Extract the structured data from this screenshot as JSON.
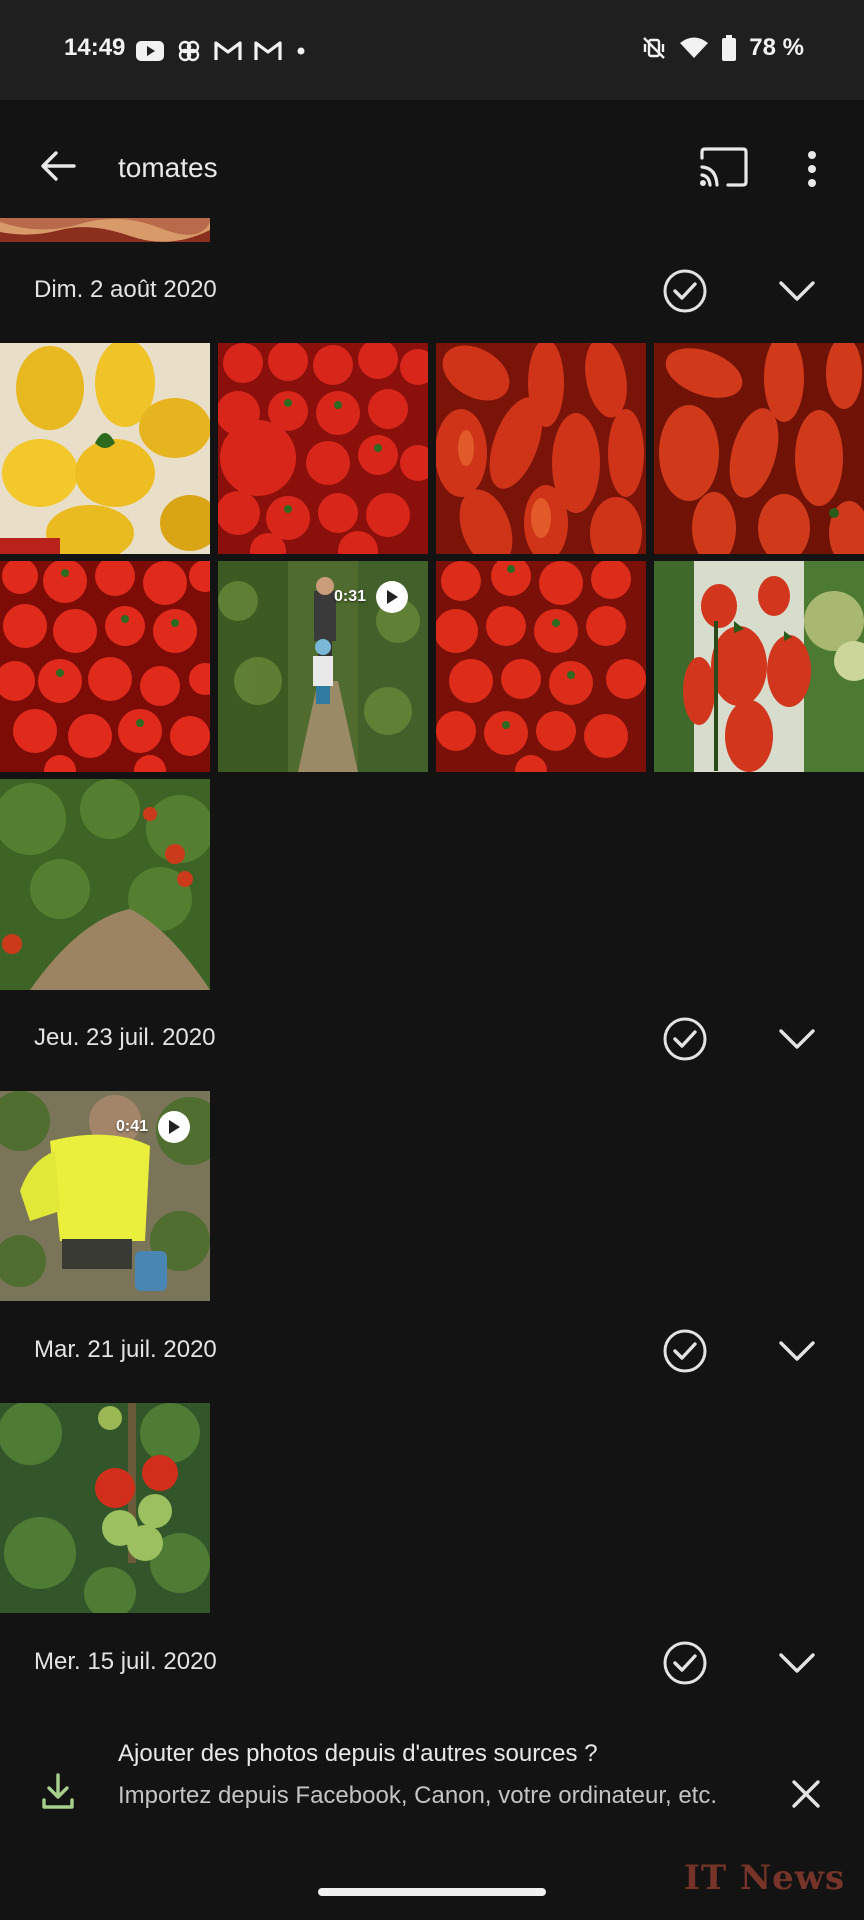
{
  "status_bar": {
    "time": "14:49",
    "notification_icons": [
      "youtube-icon",
      "pinwheel-icon",
      "gmail-icon",
      "gmail-icon",
      "dot-icon"
    ],
    "right_icons": [
      "mute-vibrate-icon",
      "wifi-icon",
      "battery-icon"
    ],
    "battery": "78 %"
  },
  "app_bar": {
    "search_query": "tomates",
    "back_icon": "arrow-back-icon",
    "cast_icon": "cast-icon",
    "more_icon": "more-vert-icon"
  },
  "sections": [
    {
      "date": "Dim. 2 août 2020",
      "photo_count": 9,
      "video_durations": [
        "0:31"
      ]
    },
    {
      "date": "Jeu. 23 juil. 2020",
      "photo_count": 1,
      "video_durations": [
        "0:41"
      ]
    },
    {
      "date": "Mar. 21 juil. 2020",
      "photo_count": 1,
      "video_durations": []
    },
    {
      "date": "Mer. 15 juil. 2020",
      "photo_count": 0,
      "video_durations": []
    }
  ],
  "banner": {
    "title": "Ajouter des photos depuis d'autres sources ?",
    "text": "Importez depuis Facebook, Canon, votre ordinateur, etc.",
    "accent_color": "#a8d08d"
  },
  "watermark": "IT News"
}
